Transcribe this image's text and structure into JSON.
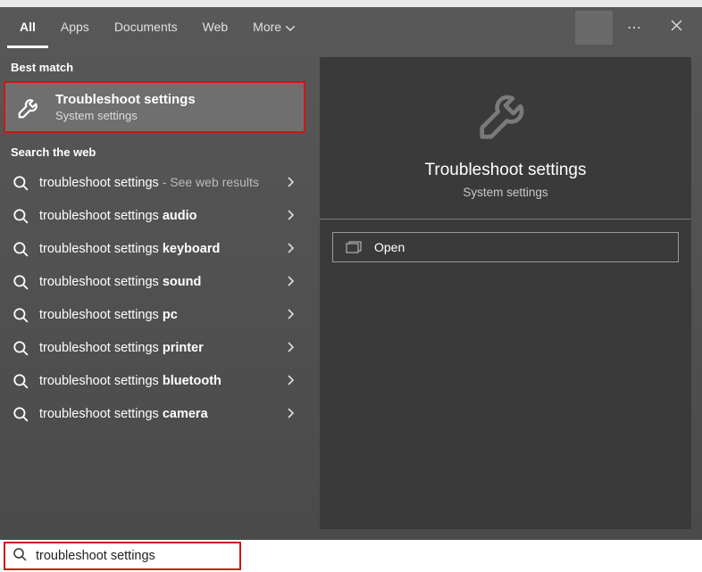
{
  "tabs": {
    "all": "All",
    "apps": "Apps",
    "documents": "Documents",
    "web": "Web",
    "more": "More"
  },
  "sections": {
    "best_match": "Best match",
    "search_web": "Search the web"
  },
  "best_match": {
    "title": "Troubleshoot settings",
    "subtitle": "System settings"
  },
  "web_results": [
    {
      "base": "troubleshoot settings",
      "bold": "",
      "extra": " - See web results"
    },
    {
      "base": "troubleshoot settings ",
      "bold": "audio",
      "extra": ""
    },
    {
      "base": "troubleshoot settings ",
      "bold": "keyboard",
      "extra": ""
    },
    {
      "base": "troubleshoot settings ",
      "bold": "sound",
      "extra": ""
    },
    {
      "base": "troubleshoot settings ",
      "bold": "pc",
      "extra": ""
    },
    {
      "base": "troubleshoot settings ",
      "bold": "printer",
      "extra": ""
    },
    {
      "base": "troubleshoot settings ",
      "bold": "bluetooth",
      "extra": ""
    },
    {
      "base": "troubleshoot settings ",
      "bold": "camera",
      "extra": ""
    }
  ],
  "preview": {
    "title": "Troubleshoot settings",
    "subtitle": "System settings",
    "open_label": "Open"
  },
  "search": {
    "value": "troubleshoot settings"
  },
  "icons": {
    "ellipsis": "⋯"
  }
}
